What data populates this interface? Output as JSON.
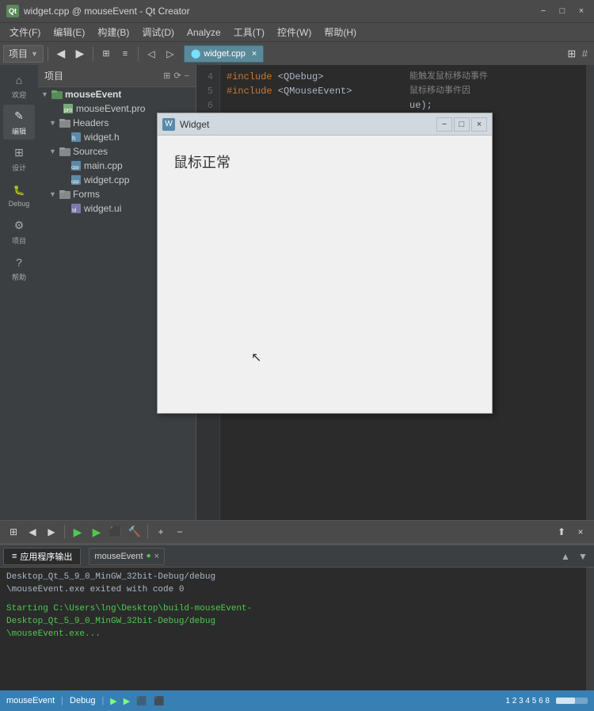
{
  "titlebar": {
    "title": "widget.cpp @ mouseEvent - Qt Creator",
    "icon_label": "Qt",
    "minimize_label": "−",
    "maximize_label": "□",
    "close_label": "×"
  },
  "menubar": {
    "items": [
      {
        "label": "文件(F)"
      },
      {
        "label": "编辑(E)"
      },
      {
        "label": "构建(B)"
      },
      {
        "label": "调试(D)"
      },
      {
        "label": "Analyze"
      },
      {
        "label": "工具(T)"
      },
      {
        "label": "控件(W)"
      },
      {
        "label": "帮助(H)"
      }
    ]
  },
  "toolbar": {
    "project_dropdown": "项目",
    "tab_label": "widget.cpp",
    "tab_close": "×"
  },
  "sidebar": {
    "items": [
      {
        "label": "欢迎",
        "icon": "⌂"
      },
      {
        "label": "编辑",
        "icon": "✎"
      },
      {
        "label": "设计",
        "icon": "⊞"
      },
      {
        "label": "Debug",
        "icon": "🐛"
      },
      {
        "label": "项目",
        "icon": "⚙"
      },
      {
        "label": "帮助",
        "icon": "?"
      },
      {
        "label": "Debug",
        "icon": "▶"
      }
    ]
  },
  "project_panel": {
    "header": "项目",
    "tree": [
      {
        "label": "mouseEvent",
        "level": 0,
        "arrow": "▼",
        "icon_color": "#5a8a5a",
        "icon": "📁"
      },
      {
        "label": "mouseEvent.pro",
        "level": 1,
        "arrow": "",
        "icon": "📄"
      },
      {
        "label": "Headers",
        "level": 1,
        "arrow": "▼",
        "icon": "📁",
        "icon_color": "#888"
      },
      {
        "label": "widget.h",
        "level": 2,
        "arrow": "",
        "icon": "📄"
      },
      {
        "label": "Sources",
        "level": 1,
        "arrow": "▼",
        "icon": "📁",
        "icon_color": "#888"
      },
      {
        "label": "main.cpp",
        "level": 2,
        "arrow": "",
        "icon": "📄"
      },
      {
        "label": "widget.cpp",
        "level": 2,
        "arrow": "",
        "icon": "📄"
      },
      {
        "label": "Forms",
        "level": 1,
        "arrow": "▼",
        "icon": "📁",
        "icon_color": "#888"
      },
      {
        "label": "widget.ui",
        "level": 2,
        "arrow": "",
        "icon": "📄"
      }
    ]
  },
  "editor": {
    "tab_label": "widget.cpp",
    "tab_close": "×",
    "hash_symbol": "#",
    "lines": [
      {
        "num": "4",
        "code": "#include <QDebug>"
      },
      {
        "num": "5",
        "code": "#include <QMouseEvent>"
      },
      {
        "num": "6",
        "code": ""
      }
    ],
    "right_content": [
      "能触发鼠标移动事件",
      "鼠标移动事件因",
      "ue);"
    ],
    "right_content2": [
      ");",
      ""
    ]
  },
  "widget_window": {
    "title": "Widget",
    "icon": "W",
    "minimize": "−",
    "maximize": "□",
    "close": "×",
    "content_text": "鼠标正常"
  },
  "bottom_panel": {
    "tab_label": "应用程序输出",
    "tab_icon": "≡",
    "process_tab": "mouseEvent",
    "process_close": "×",
    "output_lines": [
      {
        "text": "Desktop_Qt_5_9_0_MinGW_32bit-Debug/debug",
        "class": "output-normal"
      },
      {
        "text": "\\mouseEvent.exe exited with code 0",
        "class": "output-normal"
      },
      {
        "text": "",
        "class": "output-normal"
      },
      {
        "text": "Starting C:\\Users\\lng\\Desktop\\build-mouseEvent-Desktop_Qt_5_9_0_MinGW_32bit-Debug/debug\\mouseEvent.exe...",
        "class": "output-green"
      }
    ]
  },
  "statusbar": {
    "project": "mouseEvent",
    "icon_debug": "🖥",
    "label_debug": "Debug",
    "run_icon": "▶",
    "debug_icon": "▶",
    "stop_icon": "⬛",
    "build_icon": "🔨",
    "page_numbers": "1  2  3  4  5  6  8",
    "scrollbar_label": ""
  }
}
